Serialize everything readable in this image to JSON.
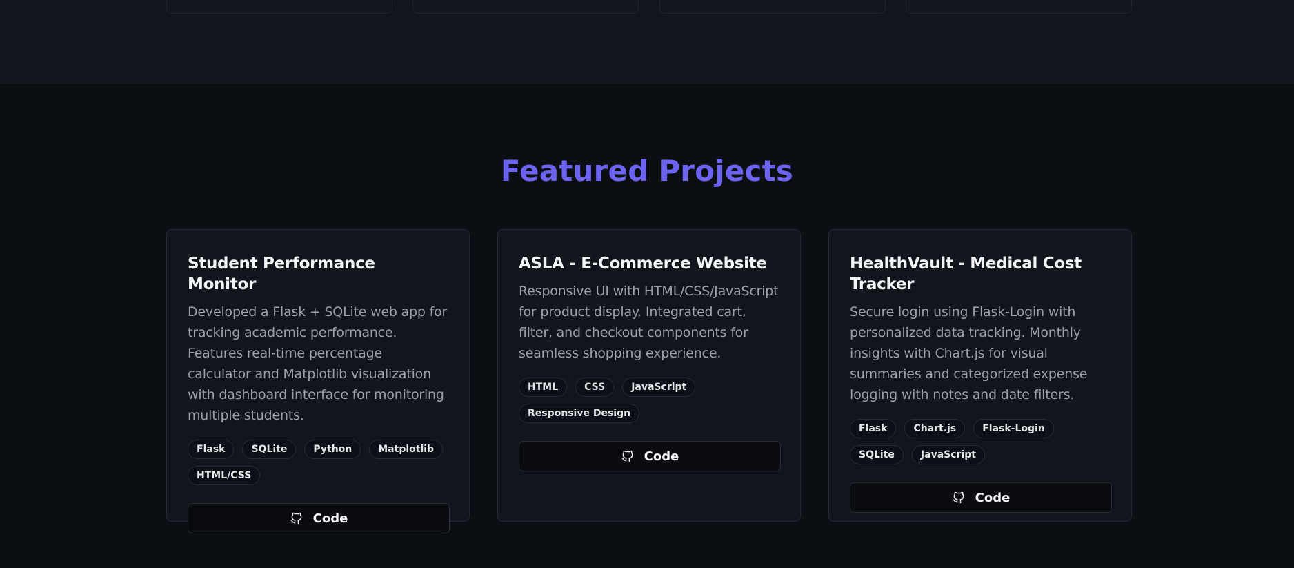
{
  "section": {
    "title": "Featured Projects"
  },
  "projects": [
    {
      "title": "Student Performance Monitor",
      "description": "Developed a Flask + SQLite web app for tracking academic performance. Features real-time percentage calculator and Matplotlib visualization with dashboard interface for monitoring multiple students.",
      "tags": [
        "Flask",
        "SQLite",
        "Python",
        "Matplotlib",
        "HTML/CSS"
      ],
      "button_label": "Code",
      "button_icon": "github-icon"
    },
    {
      "title": "ASLA - E-Commerce Website",
      "description": "Responsive UI with HTML/CSS/JavaScript for product display. Integrated cart, filter, and checkout components for seamless shopping experience.",
      "tags": [
        "HTML",
        "CSS",
        "JavaScript",
        "Responsive Design"
      ],
      "button_label": "Code",
      "button_icon": "github-icon"
    },
    {
      "title": "HealthVault - Medical Cost Tracker",
      "description": "Secure login using Flask-Login with personalized data tracking. Monthly insights with Chart.js for visual summaries and categorized expense logging with notes and date filters.",
      "tags": [
        "Flask",
        "Chart.js",
        "Flask-Login",
        "SQLite",
        "JavaScript"
      ],
      "button_label": "Code",
      "button_icon": "github-icon"
    }
  ],
  "colors": {
    "accent": "#6c63f0",
    "background": "#0b0e13",
    "card": "#12151c"
  }
}
